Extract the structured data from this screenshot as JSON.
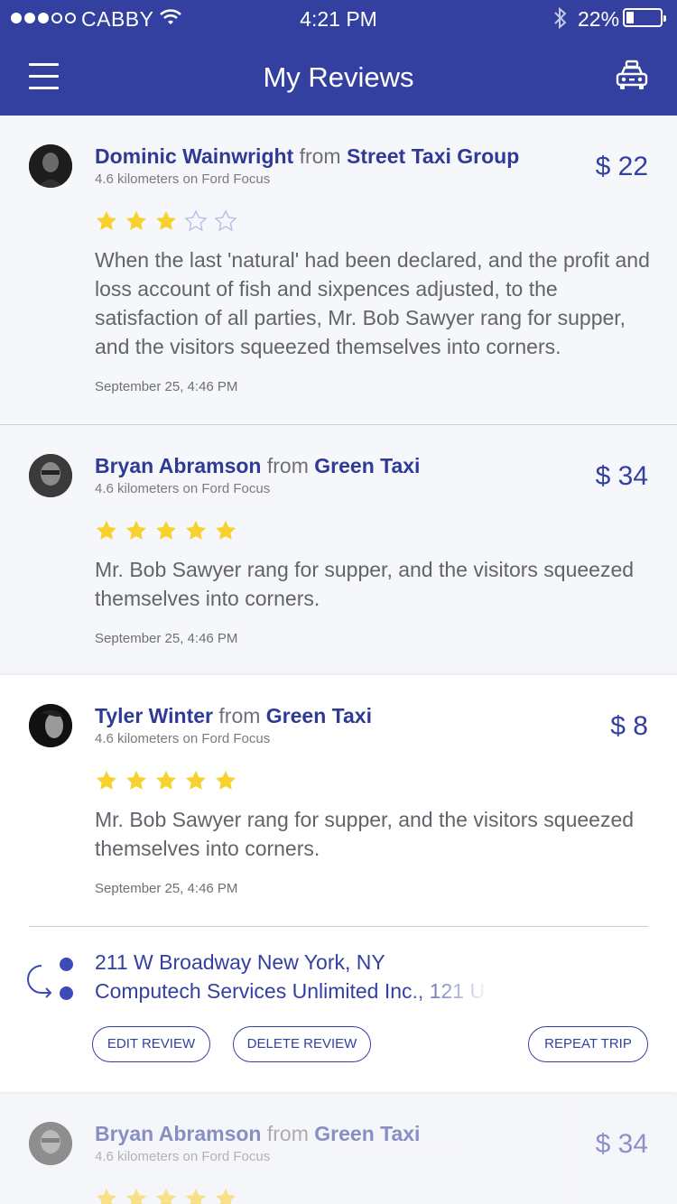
{
  "status_bar": {
    "carrier": "CABBY",
    "time": "4:21 PM",
    "battery": "22%",
    "battery_level": 0.22
  },
  "header": {
    "title": "My Reviews",
    "left_icon": "hamburger-menu-icon",
    "right_icon": "taxi-icon"
  },
  "colors": {
    "primary": "#3340a0",
    "star": "#f8d12f",
    "text_muted": "#62636b"
  },
  "reviews": [
    {
      "driver": "Dominic Wainwright",
      "from": "from",
      "company": "Street Taxi Group",
      "distance": "4.6 kilometers on Ford Focus",
      "price": "$ 22",
      "rating": 3,
      "text": "When the last 'natural' had been declared, and the profit and loss account of fish and sixpences adjusted, to the satisfaction of all parties, Mr. Bob Sawyer rang for supper, and the visitors squeezed themselves into corners.",
      "date": "September 25, 4:46 PM"
    },
    {
      "driver": "Bryan Abramson",
      "from": "from",
      "company": "Green Taxi",
      "distance": "4.6 kilometers on Ford Focus",
      "price": "$ 34",
      "rating": 5,
      "text": "Mr. Bob Sawyer rang for supper, and the visitors squeezed themselves into corners.",
      "date": "September 25, 4:46 PM"
    },
    {
      "driver": "Tyler Winter",
      "from": "from",
      "company": "Green Taxi",
      "distance": "4.6 kilometers on Ford Focus",
      "price": "$ 8",
      "rating": 5,
      "text": "Mr. Bob Sawyer rang for supper, and the visitors squeezed themselves into corners.",
      "date": "September 25, 4:46 PM",
      "route": {
        "from_address": "211 W Broadway New York, NY",
        "to_address": "Computech Services Unlimited Inc., 121 U"
      },
      "actions": {
        "edit": "EDIT REVIEW",
        "delete": "DELETE REVIEW",
        "repeat": "REPEAT TRIP"
      }
    },
    {
      "driver": "Bryan Abramson",
      "from": "from",
      "company": "Green Taxi",
      "distance": "4.6 kilometers on Ford Focus",
      "price": "$ 34",
      "rating": 5
    }
  ]
}
